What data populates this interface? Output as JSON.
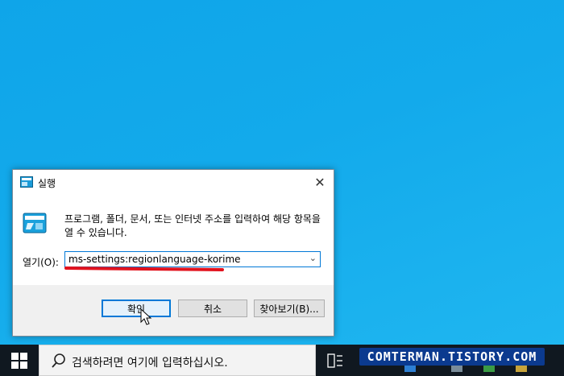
{
  "dialog": {
    "title": "실행",
    "description": "프로그램, 폴더, 문서, 또는 인터넷 주소를 입력하여 해당 항목을 열 수 있습니다.",
    "open_label": "열기(O):",
    "open_value": "ms-settings:regionlanguage-korime",
    "buttons": {
      "ok": "확인",
      "cancel": "취소",
      "browse": "찾아보기(B)..."
    }
  },
  "taskbar": {
    "search_placeholder": "검색하려면 여기에 입력하십시오."
  },
  "watermark": "COMTERMAN.TISTORY.COM",
  "colors": {
    "desktop": "#12a8e8",
    "accent": "#0078d7",
    "highlight": "#e2121d",
    "taskbar": "#101820"
  }
}
